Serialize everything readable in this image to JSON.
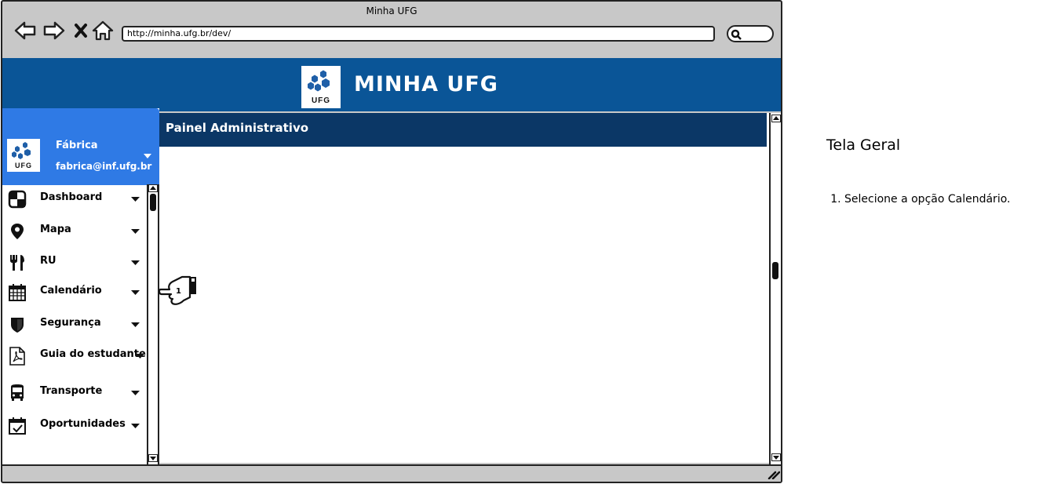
{
  "browser": {
    "window_title": "Minha UFG",
    "url": "http://minha.ufg.br/dev/"
  },
  "app": {
    "title": "MINHA UFG",
    "logo_text": "UFG"
  },
  "profile": {
    "name": "Fábrica",
    "email": "fabrica@inf.ufg.br",
    "logo_text": "UFG"
  },
  "panel": {
    "title": "Painel Administrativo"
  },
  "menu": {
    "items": [
      {
        "label": "Dashboard",
        "icon": "dashboard-icon"
      },
      {
        "label": "Mapa",
        "icon": "map-pin-icon"
      },
      {
        "label": "RU",
        "icon": "fork-knife-icon"
      },
      {
        "label": "Calendário",
        "icon": "calendar-icon"
      },
      {
        "label": "Segurança",
        "icon": "shield-icon"
      },
      {
        "label": "Guia do estudante",
        "icon": "pdf-icon"
      },
      {
        "label": "Transporte",
        "icon": "bus-icon"
      },
      {
        "label": "Oportunidades",
        "icon": "calendar-check-icon"
      }
    ]
  },
  "annotation": {
    "step_number": "1"
  },
  "notes": {
    "title": "Tela Geral",
    "steps": [
      "Selecione a opção Calendário."
    ]
  },
  "colors": {
    "header_blue": "#0a5597",
    "profile_blue": "#2f7ae5",
    "panel_header": "#0b3766",
    "chrome_gray": "#c8c8c8"
  }
}
